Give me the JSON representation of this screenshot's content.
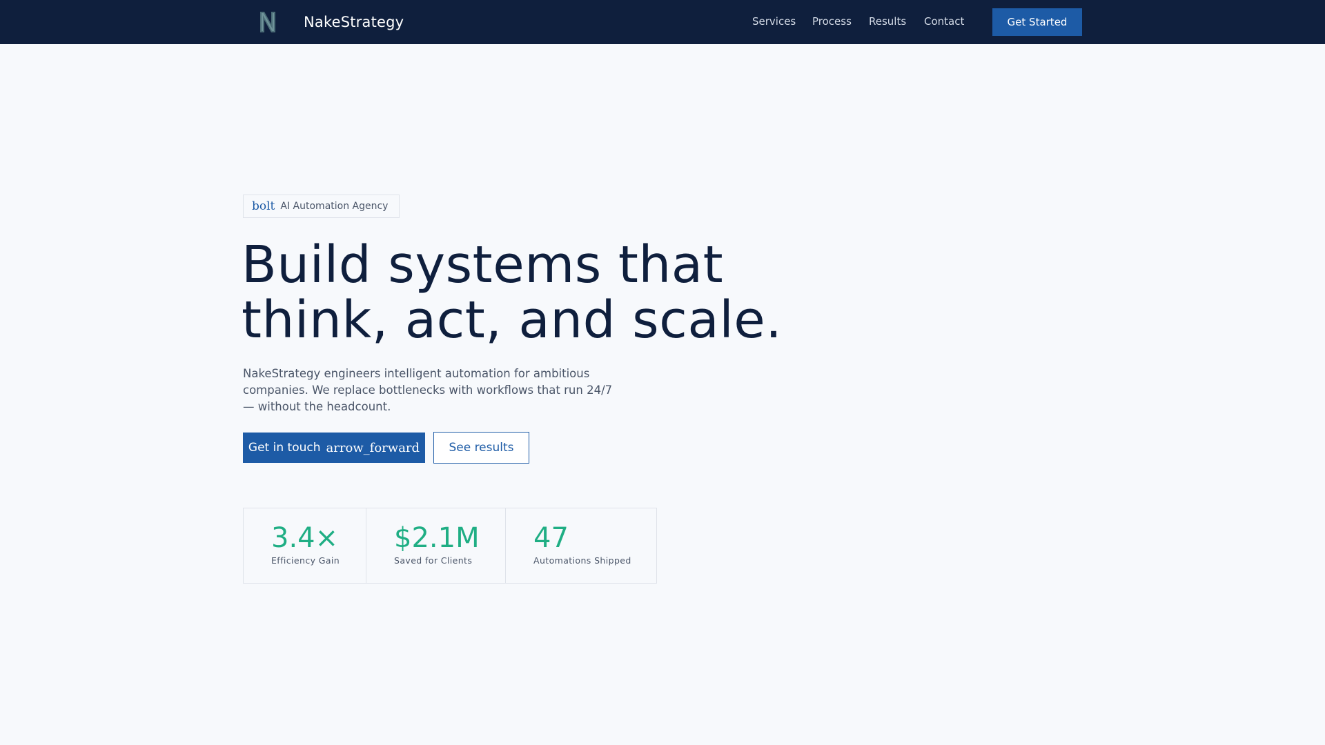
{
  "header": {
    "brand_name": "NakeStrategy",
    "logo_icon": "n-monogram-icon",
    "nav": [
      {
        "label": "Services"
      },
      {
        "label": "Process"
      },
      {
        "label": "Results"
      },
      {
        "label": "Contact"
      }
    ],
    "cta_label": "Get Started"
  },
  "hero": {
    "badge_icon": "bolt",
    "badge_text": "AI Automation Agency",
    "headline_line1": "Build systems that",
    "headline_line2": "think, act, and scale.",
    "lede": "NakeStrategy engineers intelligent automation for ambitious companies. We replace bottlenecks with workflows that run 24/7 — without the headcount.",
    "primary_button": {
      "label": "Get in touch",
      "icon": "arrow_forward"
    },
    "secondary_button": {
      "label": "See results"
    }
  },
  "stats": [
    {
      "value": "3.4×",
      "label": "Efficiency Gain"
    },
    {
      "value": "$2.1M",
      "label": "Saved for Clients"
    },
    {
      "value": "47",
      "label": "Automations Shipped"
    }
  ],
  "colors": {
    "navy": "#0f1f3d",
    "accent_blue": "#1d5ba6",
    "accent_green": "#1fae84",
    "page_bg": "#f7f9fc"
  }
}
